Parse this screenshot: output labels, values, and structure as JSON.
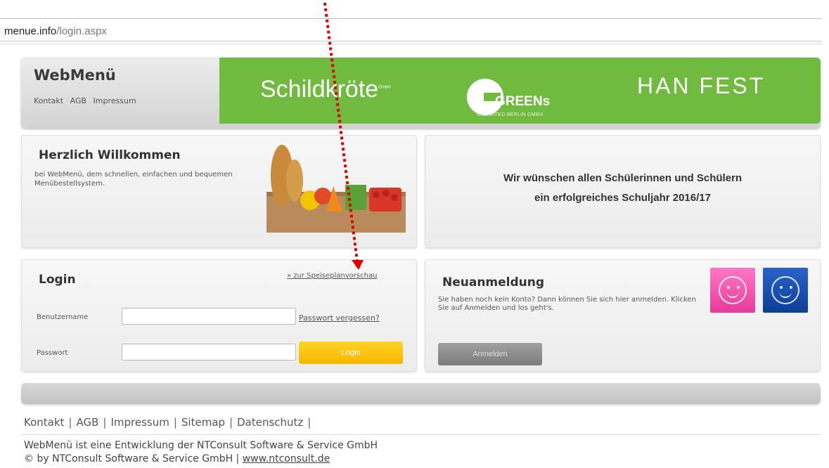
{
  "address_bar": {
    "host": "menue.info",
    "path": "/login.aspx"
  },
  "header": {
    "title": "WebMenü",
    "links": [
      "Kontakt",
      "AGB",
      "Impressum"
    ],
    "banner": {
      "brand1": "Schildkröte",
      "brand1_suffix": "GmbH",
      "brand2": "GREENs",
      "brand2_sub": "UNLIMITED BERLIN GMBH",
      "brand3": "HAN FEST"
    },
    "banner_color": "#6fba3f"
  },
  "welcome": {
    "title": "Herzlich Willkommen",
    "text": "bei WebMenü, dem schnellen, einfachen und bequemen Menübestellsystem."
  },
  "notice": {
    "line1": "Wir wünschen allen Schülerinnen und Schülern",
    "line2": "ein erfolgreiches Schuljahr 2016/17"
  },
  "login": {
    "title": "Login",
    "preview_link": "» zur Speiseplanvorschau",
    "username_label": "Benutzername",
    "username_value": "",
    "forgot_link": "Passwort vergessen?",
    "password_label": "Passwort",
    "password_value": "",
    "button_label": "Login",
    "button_color": "#f5b800"
  },
  "register": {
    "title": "Neuanmeldung",
    "text": "Sie haben noch kein Konto? Dann können Sie sich hier anmelden. Klicken Sie auf Anmelden und los geht's.",
    "button_label": "Anmelden",
    "icons": [
      "smiley-pink-icon",
      "smiley-blue-icon"
    ]
  },
  "footer": {
    "nav": [
      "Kontakt",
      "AGB",
      "Impressum",
      "Sitemap",
      "Datenschutz"
    ],
    "line1": "WebMenü ist eine Entwicklung der NTConsult Software & Service GmbH",
    "line2_prefix": "© by NTConsult Software & Service GmbH | ",
    "line2_link": "www.ntconsult.de"
  },
  "annotation": {
    "color": "#e00000"
  }
}
